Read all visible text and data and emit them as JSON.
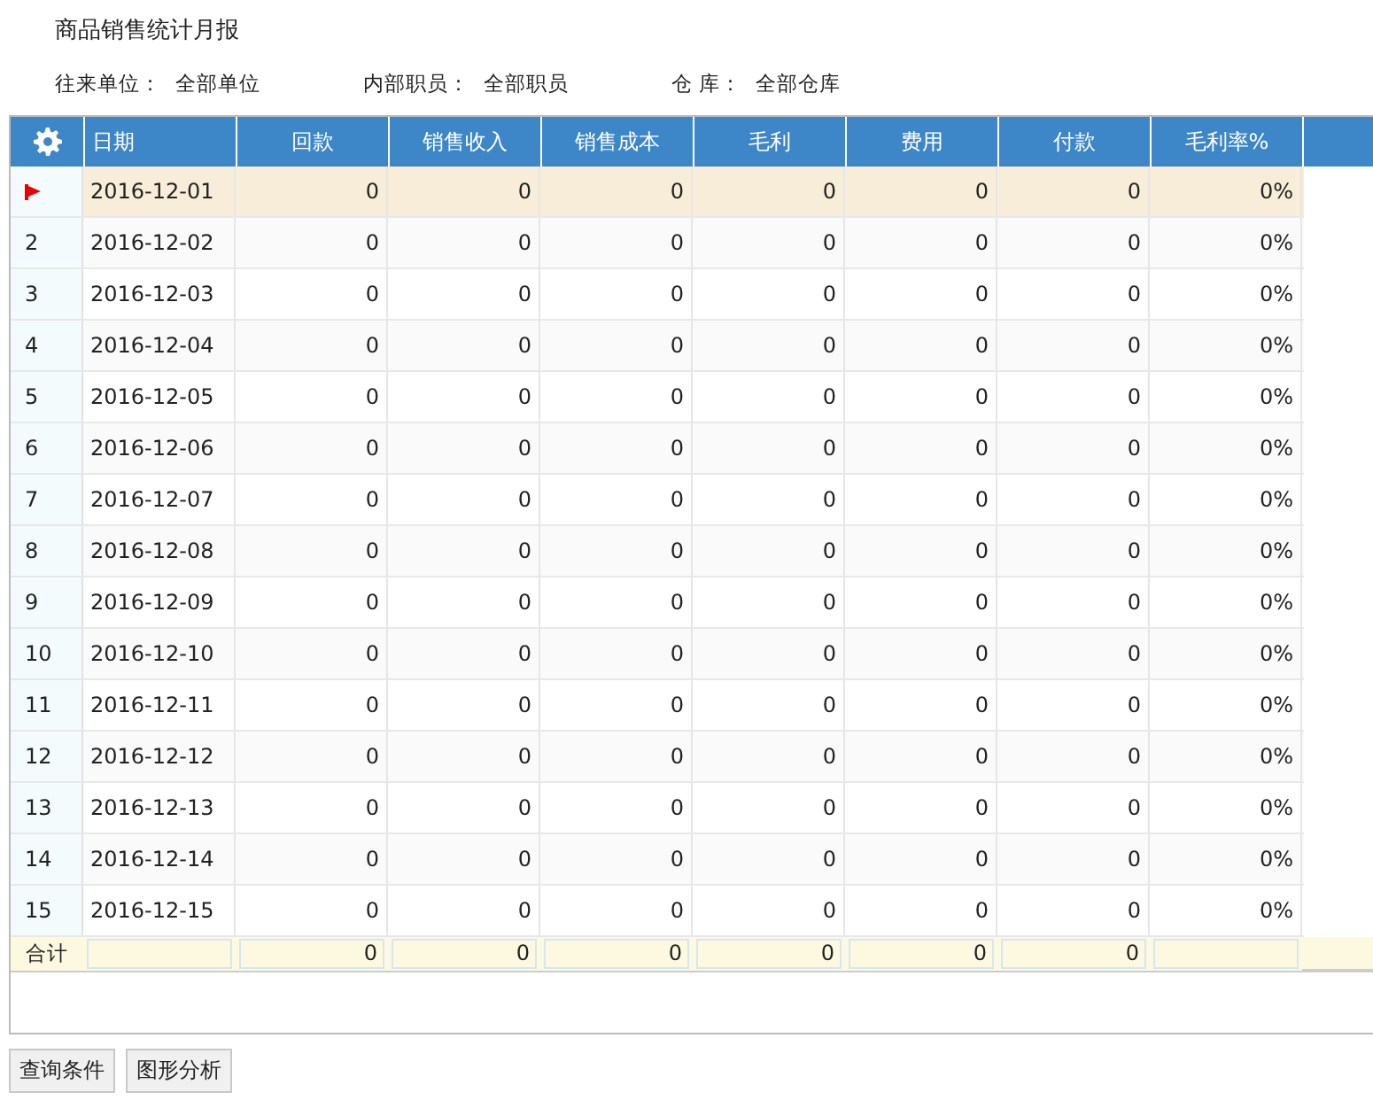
{
  "title": "商品销售统计月报",
  "filters": [
    {
      "label": "往来单位：",
      "value": "全部单位"
    },
    {
      "label": "内部职员：",
      "value": "全部职员"
    },
    {
      "label": "仓 库：",
      "value": "全部仓库"
    }
  ],
  "table": {
    "columns": [
      "日期",
      "回款",
      "销售收入",
      "销售成本",
      "毛利",
      "费用",
      "付款",
      "毛利率%"
    ],
    "rows": [
      {
        "selected": true,
        "cells": [
          "2016-12-01",
          "0",
          "0",
          "0",
          "0",
          "0",
          "0",
          "0%"
        ]
      },
      {
        "selected": false,
        "number": "2",
        "cells": [
          "2016-12-02",
          "0",
          "0",
          "0",
          "0",
          "0",
          "0",
          "0%"
        ]
      },
      {
        "selected": false,
        "number": "3",
        "cells": [
          "2016-12-03",
          "0",
          "0",
          "0",
          "0",
          "0",
          "0",
          "0%"
        ]
      },
      {
        "selected": false,
        "number": "4",
        "cells": [
          "2016-12-04",
          "0",
          "0",
          "0",
          "0",
          "0",
          "0",
          "0%"
        ]
      },
      {
        "selected": false,
        "number": "5",
        "cells": [
          "2016-12-05",
          "0",
          "0",
          "0",
          "0",
          "0",
          "0",
          "0%"
        ]
      },
      {
        "selected": false,
        "number": "6",
        "cells": [
          "2016-12-06",
          "0",
          "0",
          "0",
          "0",
          "0",
          "0",
          "0%"
        ]
      },
      {
        "selected": false,
        "number": "7",
        "cells": [
          "2016-12-07",
          "0",
          "0",
          "0",
          "0",
          "0",
          "0",
          "0%"
        ]
      },
      {
        "selected": false,
        "number": "8",
        "cells": [
          "2016-12-08",
          "0",
          "0",
          "0",
          "0",
          "0",
          "0",
          "0%"
        ]
      },
      {
        "selected": false,
        "number": "9",
        "cells": [
          "2016-12-09",
          "0",
          "0",
          "0",
          "0",
          "0",
          "0",
          "0%"
        ]
      },
      {
        "selected": false,
        "number": "10",
        "cells": [
          "2016-12-10",
          "0",
          "0",
          "0",
          "0",
          "0",
          "0",
          "0%"
        ]
      },
      {
        "selected": false,
        "number": "11",
        "cells": [
          "2016-12-11",
          "0",
          "0",
          "0",
          "0",
          "0",
          "0",
          "0%"
        ]
      },
      {
        "selected": false,
        "number": "12",
        "cells": [
          "2016-12-12",
          "0",
          "0",
          "0",
          "0",
          "0",
          "0",
          "0%"
        ]
      },
      {
        "selected": false,
        "number": "13",
        "cells": [
          "2016-12-13",
          "0",
          "0",
          "0",
          "0",
          "0",
          "0",
          "0%"
        ]
      },
      {
        "selected": false,
        "number": "14",
        "cells": [
          "2016-12-14",
          "0",
          "0",
          "0",
          "0",
          "0",
          "0",
          "0%"
        ]
      },
      {
        "selected": false,
        "number": "15",
        "cells": [
          "2016-12-15",
          "0",
          "0",
          "0",
          "0",
          "0",
          "0",
          "0%"
        ]
      }
    ],
    "totals": {
      "label": "合计",
      "cells": [
        null,
        "0",
        "0",
        "0",
        "0",
        "0",
        "0",
        null
      ]
    }
  },
  "buttons": [
    "查询条件",
    "图形分析"
  ]
}
